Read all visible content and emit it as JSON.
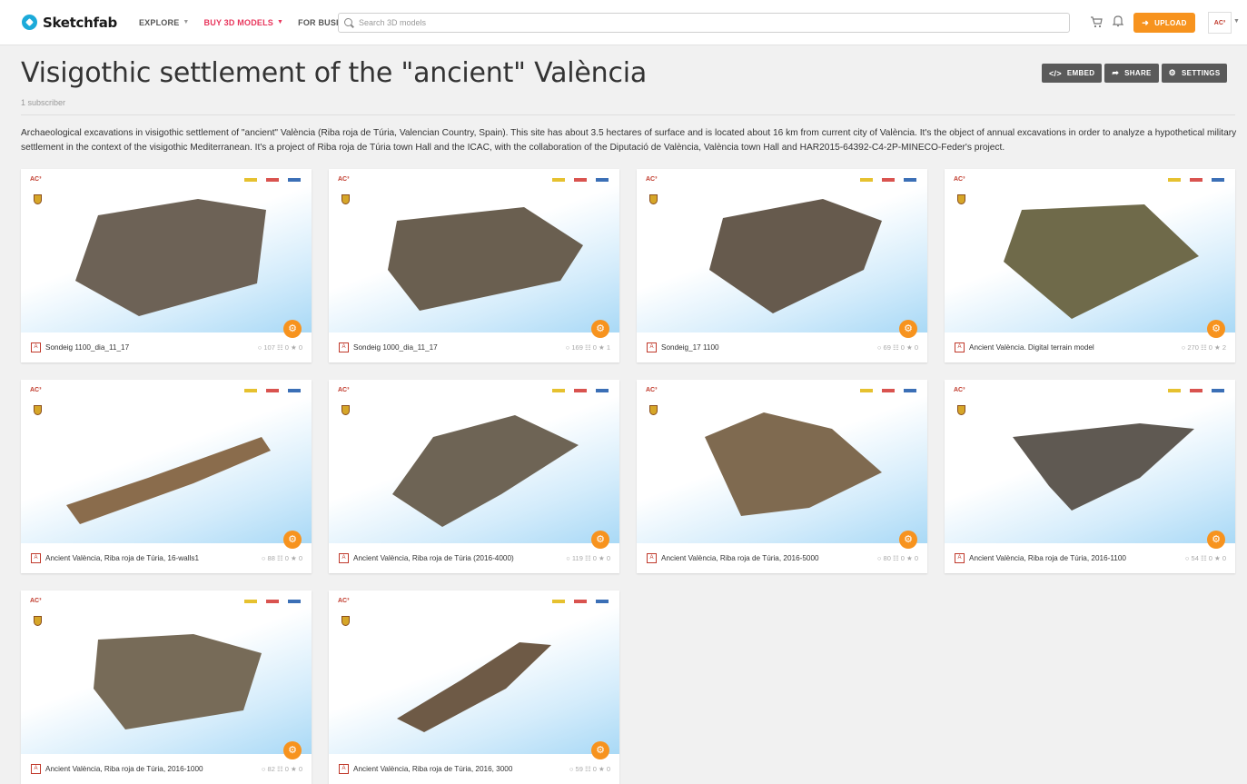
{
  "header": {
    "logo_text": "Sketchfab",
    "nav": [
      {
        "label": "EXPLORE"
      },
      {
        "label": "BUY 3D MODELS"
      },
      {
        "label": "FOR BUSINESS"
      }
    ],
    "search_placeholder": "Search 3D models",
    "upload_label": "UPLOAD",
    "avatar_text": "AC³"
  },
  "collection": {
    "title": "Visigothic settlement of the \"ancient\" València",
    "subscribers": "1 subscriber",
    "description": "Archaeological excavations in visigothic settlement of \"ancient\" València (Riba roja de Túria, Valencian Country, Spain). This site has about 3.5 hectares of surface and is located about 16 km from current city of València. It's the object of annual excavations in order to analyze a hypothetical military settlement in the context of the visigothic Mediterranean. It's a project of Riba roja de Túria town Hall and the ICAC, with the collaboration of the Diputació de València, València town Hall and HAR2015-64392-C4-2P-MINECO-Feder's project."
  },
  "actions": {
    "embed": "EMBED",
    "share": "SHARE",
    "settings": "SETTINGS"
  },
  "cards": [
    {
      "name": "Sondeig 1100_dia_11_17",
      "stats": "○ 107 ☷ 0 ★ 0"
    },
    {
      "name": "Sondeig 1000_dia_11_17",
      "stats": "○ 169 ☷ 0 ★ 1"
    },
    {
      "name": "Sondeig_17 1100",
      "stats": "○ 69 ☷ 0 ★ 0"
    },
    {
      "name": "Ancient València. Digital terrain model",
      "stats": "○ 270 ☷ 0 ★ 2"
    },
    {
      "name": "Ancient València, Riba roja de Túria, 16-walls1",
      "stats": "○ 88 ☷ 0 ★ 0"
    },
    {
      "name": "Ancient València, Riba roja de Túria (2016-4000)",
      "stats": "○ 119 ☷ 0 ★ 0"
    },
    {
      "name": "Ancient València, Riba roja de Túria, 2016-5000",
      "stats": "○ 80 ☷ 0 ★ 0"
    },
    {
      "name": "Ancient València, Riba roja de Túria, 2016-1100",
      "stats": "○ 54 ☷ 0 ★ 0"
    },
    {
      "name": "Ancient València, Riba roja de Túria, 2016-1000",
      "stats": "○ 82 ☷ 0 ★ 0"
    },
    {
      "name": "Ancient València, Riba roja de Túria, 2016, 3000",
      "stats": "○ 59 ☷ 0 ★ 0"
    }
  ],
  "colors": {
    "accent": "#f7931e",
    "buy_nav": "#e8365c",
    "logo": "#1caad9"
  }
}
